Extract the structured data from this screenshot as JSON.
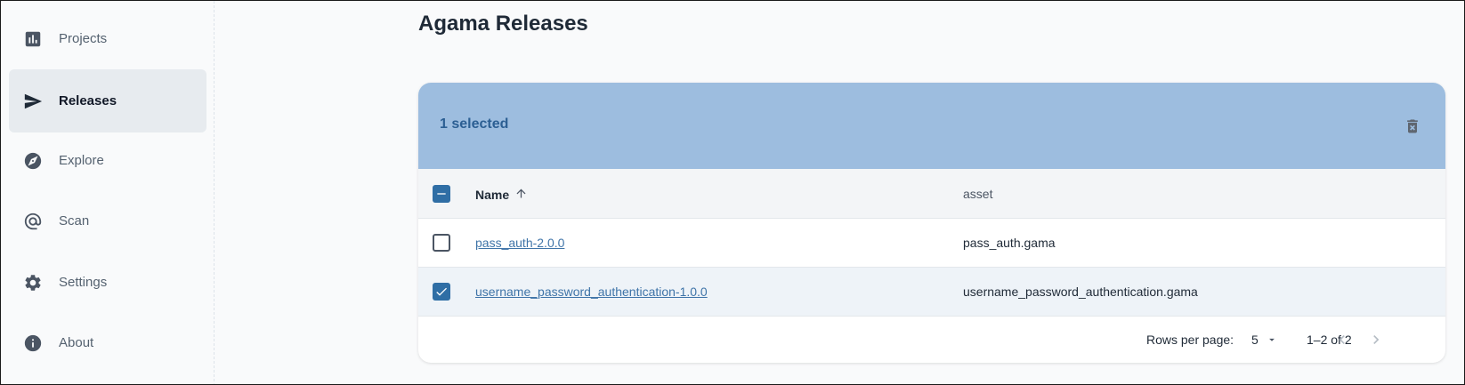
{
  "sidebar": {
    "items": [
      {
        "label": "Projects",
        "icon": "chart-icon",
        "active": false
      },
      {
        "label": "Releases",
        "icon": "send-icon",
        "active": true
      },
      {
        "label": "Explore",
        "icon": "compass-icon",
        "active": false
      },
      {
        "label": "Scan",
        "icon": "target-icon",
        "active": false
      },
      {
        "label": "Settings",
        "icon": "gear-icon",
        "active": false
      },
      {
        "label": "About",
        "icon": "info-icon",
        "active": false
      }
    ]
  },
  "page": {
    "title": "Agama Releases"
  },
  "table": {
    "selected_text": "1 selected",
    "columns": {
      "name": "Name",
      "asset": "asset"
    },
    "rows": [
      {
        "name": "pass_auth-2.0.0",
        "asset": "pass_auth.gama",
        "checked": false
      },
      {
        "name": "username_password_authentication-1.0.0",
        "asset": "username_password_authentication.gama",
        "checked": true
      }
    ],
    "footer": {
      "rows_per_page_label": "Rows per page:",
      "rows_per_page_value": "5",
      "page_info": "1–2 of 2"
    }
  },
  "colors": {
    "toolbar": "#9dbddf",
    "accent": "#2f6ea5",
    "link": "#3f74a8"
  }
}
